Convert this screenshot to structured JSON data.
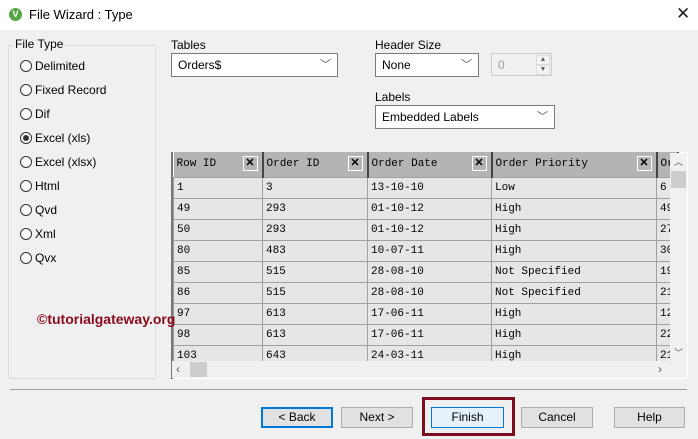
{
  "window": {
    "title": "File Wizard : Type",
    "logo_letter": "V"
  },
  "file_type": {
    "label": "File Type",
    "options": [
      "Delimited",
      "Fixed Record",
      "Dif",
      "Excel (xls)",
      "Excel (xlsx)",
      "Html",
      "Qvd",
      "Xml",
      "Qvx"
    ],
    "selected": "Excel (xls)"
  },
  "tables": {
    "label": "Tables",
    "value": "Orders$"
  },
  "header_size": {
    "label": "Header Size",
    "value": "None",
    "spinner_value": "0"
  },
  "labels": {
    "label": "Labels",
    "value": "Embedded Labels"
  },
  "grid": {
    "columns": [
      "Row ID",
      "Order ID",
      "Order Date",
      "Order Priority",
      "Or"
    ],
    "rows": [
      [
        "1",
        "3",
        "13-10-10",
        "Low",
        "6"
      ],
      [
        "49",
        "293",
        "01-10-12",
        "High",
        "49"
      ],
      [
        "50",
        "293",
        "01-10-12",
        "High",
        "27"
      ],
      [
        "80",
        "483",
        "10-07-11",
        "High",
        "30"
      ],
      [
        "85",
        "515",
        "28-08-10",
        "Not Specified",
        "19"
      ],
      [
        "86",
        "515",
        "28-08-10",
        "Not Specified",
        "21"
      ],
      [
        "97",
        "613",
        "17-06-11",
        "High",
        "12"
      ],
      [
        "98",
        "613",
        "17-06-11",
        "High",
        "22"
      ],
      [
        "103",
        "643",
        "24-03-11",
        "High",
        "21"
      ]
    ]
  },
  "watermark": "©tutorialgateway.org",
  "buttons": {
    "back": "< Back",
    "next": "Next >",
    "finish": "Finish",
    "cancel": "Cancel",
    "help": "Help"
  },
  "colors": {
    "highlight": "#7b0d1e",
    "focus": "#0078d7"
  }
}
